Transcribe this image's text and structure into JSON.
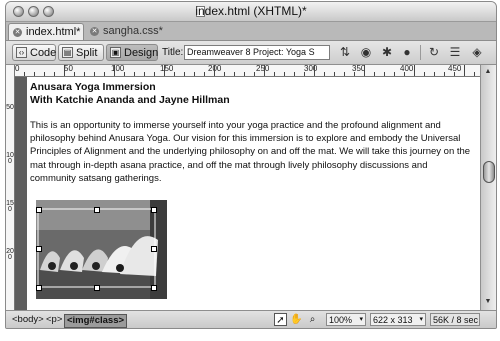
{
  "window": {
    "title": "index.html (XHTML)*",
    "buttons": [
      "close-button",
      "minimize-button",
      "zoom-button"
    ]
  },
  "tabs": [
    {
      "label": "index.html*",
      "active": true
    },
    {
      "label": "sangha.css*",
      "active": false
    }
  ],
  "toolbar": {
    "code_label": "Code",
    "split_label": "Split",
    "design_label": "Design",
    "title_label": "Title:",
    "title_value": "Dreamweaver 8 Project: Yoga S",
    "icons": [
      "file-management-icon",
      "preview-icon",
      "refresh-icon",
      "view-options-icon",
      "visual-aids-icon"
    ]
  },
  "ruler": {
    "marks": [
      "0",
      "50",
      "100",
      "150",
      "200",
      "250",
      "300",
      "350",
      "400",
      "450"
    ],
    "left_marks": [
      "50",
      "100",
      "150",
      "200"
    ]
  },
  "content": {
    "heading_1": "Anusara Yoga Immersion",
    "heading_2": "With Katchie Ananda and Jayne Hillman",
    "paragraph": "This is an opportunity to immerse yourself into your yoga practice and the profound alignment and philosophy behind Anusara Yoga. Our vision for this immersion is to explore and embody the Universal Principles of Alignment and the underlying philosophy on and off the mat. We will take this journey on the mat through in-depth asana practice, and off the mat through lively philosophy discussions and community satsang gatherings.",
    "image_alt": "yoga class photo (selected)"
  },
  "status": {
    "tags": [
      "<body>",
      "<p>",
      "<img#class>"
    ],
    "zoom": "100%",
    "dimensions": "622 x 313",
    "download": "56K / 8 sec",
    "tools": [
      "select-tool-icon",
      "hand-tool-icon",
      "zoom-tool-icon"
    ]
  },
  "colors": {
    "window_bg": "#cfcfcf",
    "selected_tag": "#9b9b9b",
    "design_bg": "#ffffff"
  }
}
